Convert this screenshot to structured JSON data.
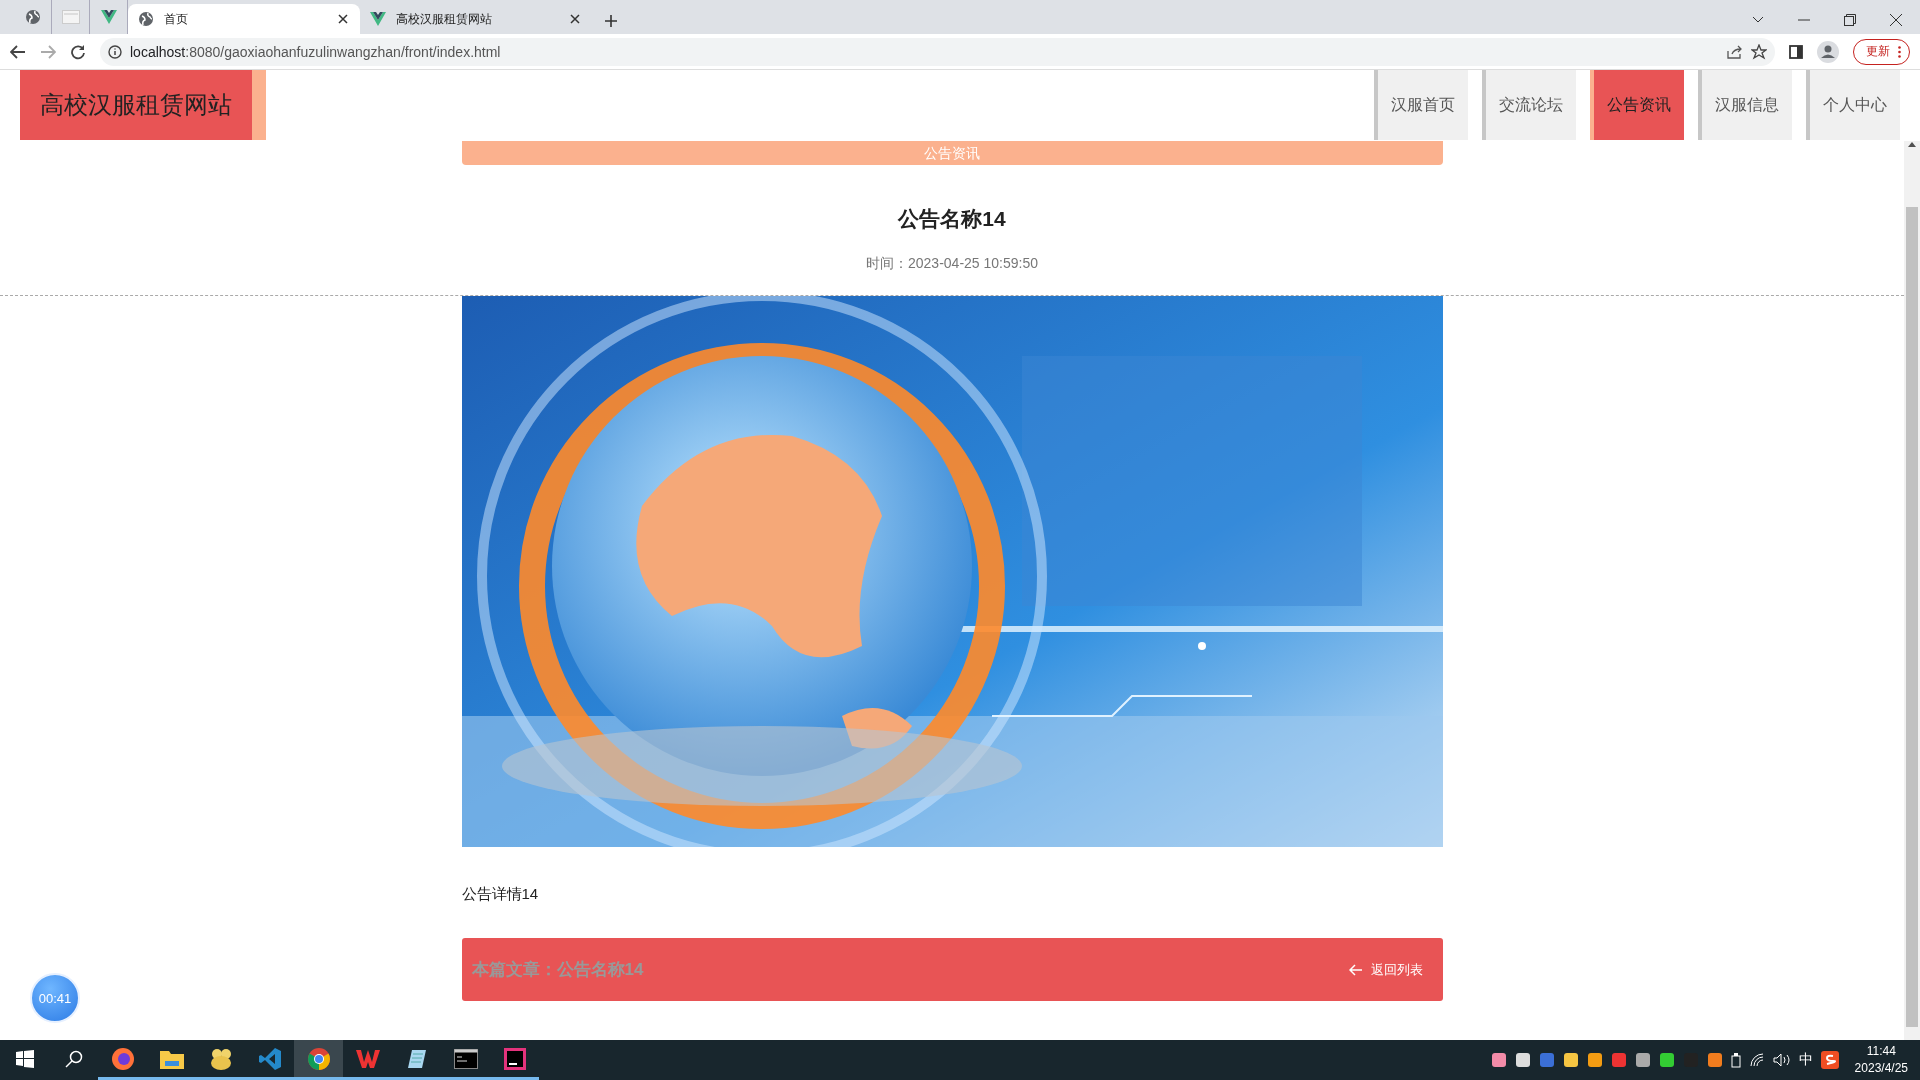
{
  "browser": {
    "pinned_tabs": [
      {
        "kind": "globe"
      },
      {
        "kind": "page"
      },
      {
        "kind": "vue"
      }
    ],
    "tabs": [
      {
        "kind": "globe",
        "title": "首页",
        "selected": true
      },
      {
        "kind": "vue",
        "title": "高校汉服租赁网站",
        "selected": false
      }
    ],
    "url_host": "localhost",
    "url_rest": ":8080/gaoxiaohanfuzulinwangzhan/front/index.html",
    "update_button": "更新"
  },
  "site": {
    "logo": "高校汉服租赁网站",
    "nav": [
      {
        "label": "汉服首页",
        "selected": false
      },
      {
        "label": "交流论坛",
        "selected": false
      },
      {
        "label": "公告资讯",
        "selected": true
      },
      {
        "label": "汉服信息",
        "selected": false
      },
      {
        "label": "个人中心",
        "selected": false
      }
    ]
  },
  "banner": "公告资讯",
  "article": {
    "title": "公告名称14",
    "time": "时间：2023-04-25 10:59:50",
    "body": "公告详情14"
  },
  "footer_bar": {
    "current": "本篇文章：公告名称14",
    "back": "返回列表"
  },
  "timer": "00:41",
  "taskbar": {
    "apps": [
      {
        "kind": "browser",
        "selected": false
      },
      {
        "kind": "folder",
        "selected": false
      },
      {
        "kind": "blob",
        "selected": false
      },
      {
        "kind": "editor",
        "selected": false
      },
      {
        "kind": "chrome",
        "selected": true
      },
      {
        "kind": "office",
        "selected": false
      },
      {
        "kind": "notepad",
        "selected": false
      },
      {
        "kind": "terminal",
        "selected": false
      },
      {
        "kind": "ide",
        "selected": false
      }
    ],
    "ime": "中",
    "time": "11:44",
    "date": "2023/4/25"
  }
}
